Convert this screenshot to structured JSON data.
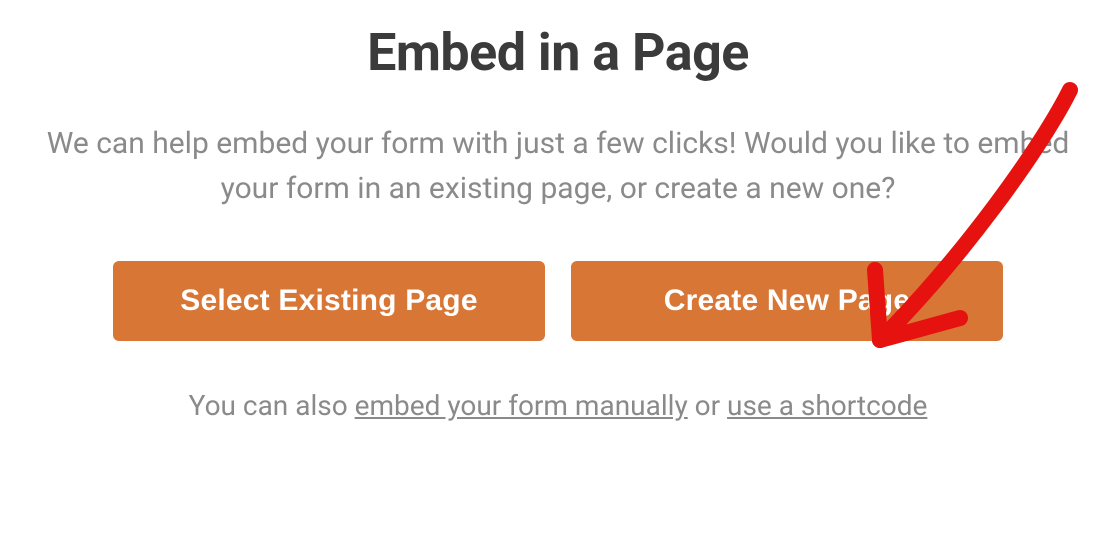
{
  "modal": {
    "title": "Embed in a Page",
    "description": "We can help embed your form with just a few clicks! Would you like to embed your form in an existing page, or create a new one?",
    "buttons": {
      "select_existing": "Select Existing Page",
      "create_new": "Create New Page"
    },
    "footer": {
      "prefix": "You can also ",
      "link_manual": "embed your form manually",
      "middle": " or ",
      "link_shortcode": "use a shortcode"
    }
  },
  "colors": {
    "button_bg": "#d87636",
    "heading": "#3b3b3b",
    "body_text": "#8a8a8a",
    "annotation": "#e5120f"
  }
}
